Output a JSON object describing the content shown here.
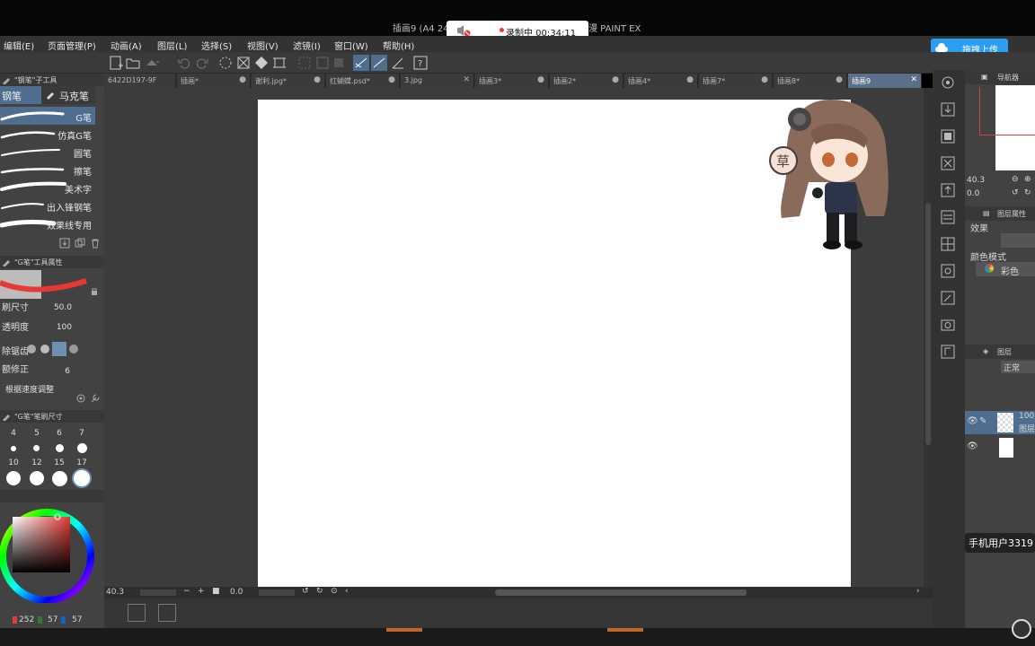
{
  "window": {
    "title": "插画9 (A4 24",
    "brand": "漫 PAINT EX"
  },
  "recorder": {
    "status": "录制中 00:34:11"
  },
  "menu": [
    "编辑(E)",
    "页面管理(P)",
    "动画(A)",
    "图层(L)",
    "选择(S)",
    "视图(V)",
    "滤镜(I)",
    "窗口(W)",
    "帮助(H)"
  ],
  "upload": {
    "label": "拖拽上传"
  },
  "tool_panel": {
    "title": "\"钢笔\"子工具",
    "tabs": [
      "钢笔",
      "马克笔"
    ],
    "brushes": [
      "G笔",
      "仿真G笔",
      "圆笔",
      "擦笔",
      "美术字",
      "出入锋钢笔",
      "效果线专用"
    ]
  },
  "tool_props": {
    "title": "\"G笔\"工具属性",
    "brush_size_label": "刷尺寸",
    "brush_size_value": "50.0",
    "opacity_label": "透明度",
    "opacity_value": "100",
    "antialias_label": "除锯齿",
    "correction_label": "额修正",
    "correction_value": "6",
    "speed_label": "根据速度调整"
  },
  "brush_size_panel": {
    "title": "\"G笔\"笔刷尺寸",
    "row1": [
      "4",
      "5",
      "6",
      "7"
    ],
    "row2": [
      "10",
      "12",
      "15",
      "17"
    ]
  },
  "color": {
    "r": "252",
    "g": "57",
    "b": "57",
    "accent": "#e53935"
  },
  "tabs": [
    {
      "label": "6422D197-9F",
      "active": false
    },
    {
      "label": "插画*",
      "active": false
    },
    {
      "label": "谢利.jpg*",
      "active": false
    },
    {
      "label": "红蝴蝶.psd*",
      "active": false
    },
    {
      "label": "3.jpg",
      "active": false
    },
    {
      "label": "插画3*",
      "active": false
    },
    {
      "label": "插画2*",
      "active": false
    },
    {
      "label": "插画4*",
      "active": false
    },
    {
      "label": "插画7*",
      "active": false
    },
    {
      "label": "插画8*",
      "active": false
    },
    {
      "label": "插画9",
      "active": true
    }
  ],
  "status": {
    "zoom": "40.3",
    "angle": "0.0"
  },
  "navigator": {
    "title": "导航器",
    "zoom": "40.3",
    "angle": "0.0"
  },
  "layer_props": {
    "title": "图层属性",
    "effect_label": "效果",
    "color_mode_label": "颜色模式",
    "color_mode_value": "彩色"
  },
  "layers": {
    "title": "图层",
    "blend": "正常",
    "opacity": "100",
    "layer_name": "图层"
  },
  "user_badge": "手机用户3319",
  "bubble_char": "草"
}
